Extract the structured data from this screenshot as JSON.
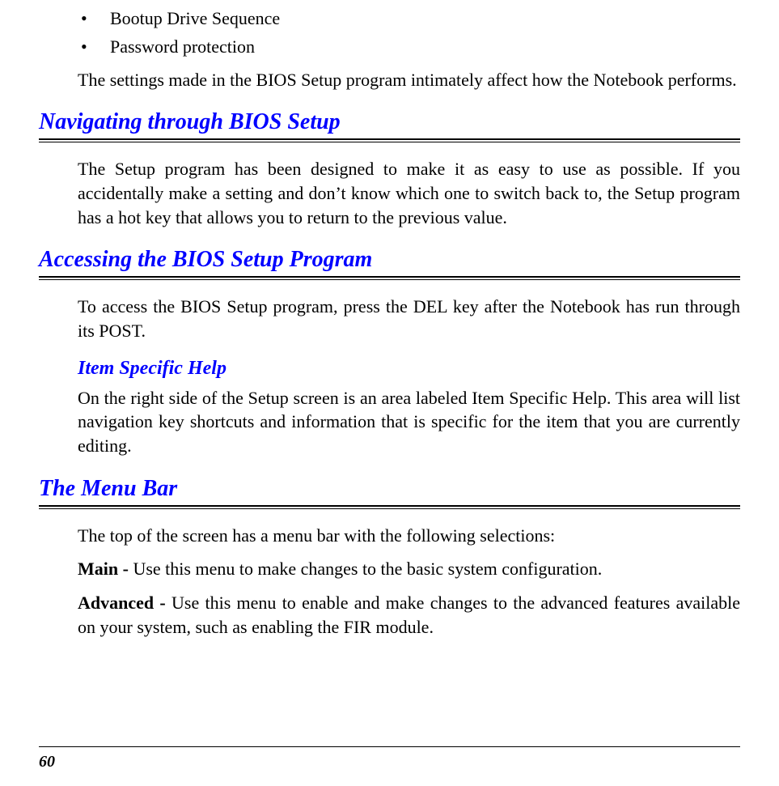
{
  "bullets": {
    "item1": "Bootup Drive Sequence",
    "item2": "Password protection"
  },
  "intro_para": "The settings made in the BIOS Setup program intimately affect how the Notebook performs.",
  "sections": {
    "nav": {
      "heading": "Navigating through BIOS Setup",
      "para": "The Setup program has been designed to make it as easy to use as possible.  If you accidentally make a setting and don’t know which one to switch back to, the Setup program has a hot key that allows you to return to the previous value."
    },
    "access": {
      "heading": "Accessing the BIOS Setup Program",
      "para": "To access the BIOS Setup program, press the DEL key after the Notebook has run through its POST.",
      "sub": {
        "heading": "Item Specific Help",
        "para": "On the right side of the Setup screen is an area labeled Item Specific Help.  This area will list navigation key shortcuts and information that is specific for the item that you are currently editing."
      }
    },
    "menubar": {
      "heading": "The Menu Bar",
      "para1": "The top of the screen has a menu bar with the following selections:",
      "main_label": "Main - ",
      "main_text": "Use this menu to make changes to the basic system configuration.",
      "adv_label": "Advanced - ",
      "adv_text": "Use this menu to enable and make changes to the advanced features available on your system, such as enabling the FIR module."
    }
  },
  "page_number": "60"
}
